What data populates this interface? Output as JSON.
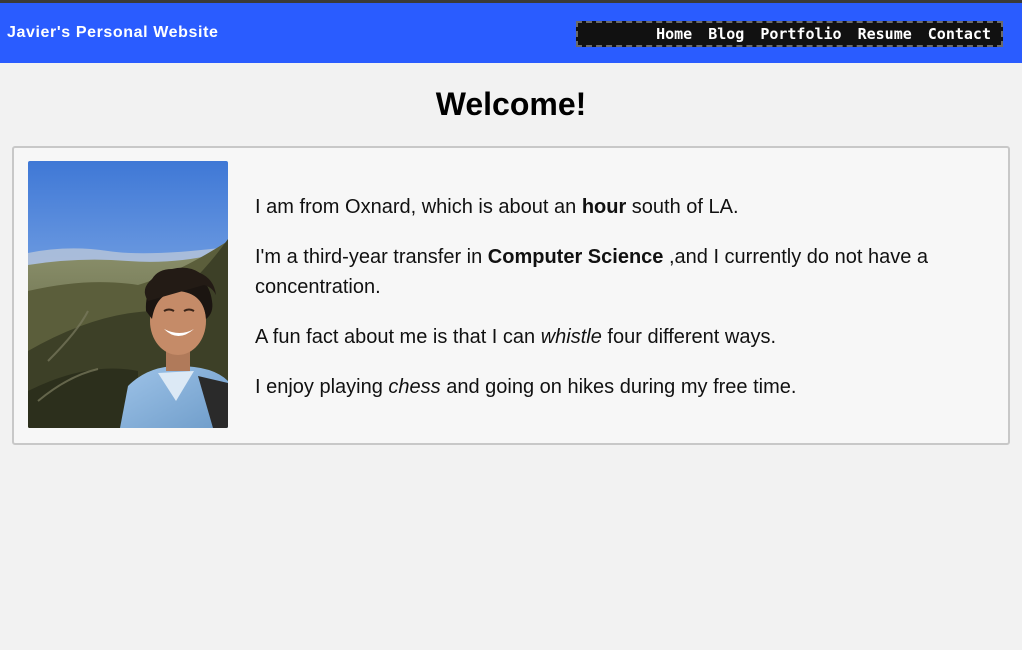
{
  "header": {
    "site_title": "Javier's Personal Website",
    "nav": [
      "Home",
      "Blog",
      "Portfolio",
      "Resume",
      "Contact"
    ]
  },
  "main": {
    "heading": "Welcome!",
    "photo_icon": "profile-photo",
    "bio": [
      {
        "before": "I am from Oxnard, which is about an ",
        "emph": "hour",
        "emph_style": "bold",
        "after": " south of LA.",
        "cont": ""
      },
      {
        "before": "I'm a third-year transfer in ",
        "emph": "Computer Science",
        "emph_style": "bold",
        "after": " ,and I currently do not have a",
        "cont": "concentration."
      },
      {
        "before": "A fun fact about me is that I can ",
        "emph": "whistle",
        "emph_style": "italic",
        "after": " four different ways.",
        "cont": ""
      },
      {
        "before": "I enjoy playing ",
        "emph": "chess",
        "emph_style": "italic",
        "after": " and going on hikes during my free time.",
        "cont": ""
      }
    ]
  },
  "colors": {
    "header_bg": "#2a5cff",
    "nav_bg": "#111111",
    "page_bg": "#f2f2f2",
    "card_bg": "#f7f7f7",
    "card_border": "#c8c8c8"
  }
}
